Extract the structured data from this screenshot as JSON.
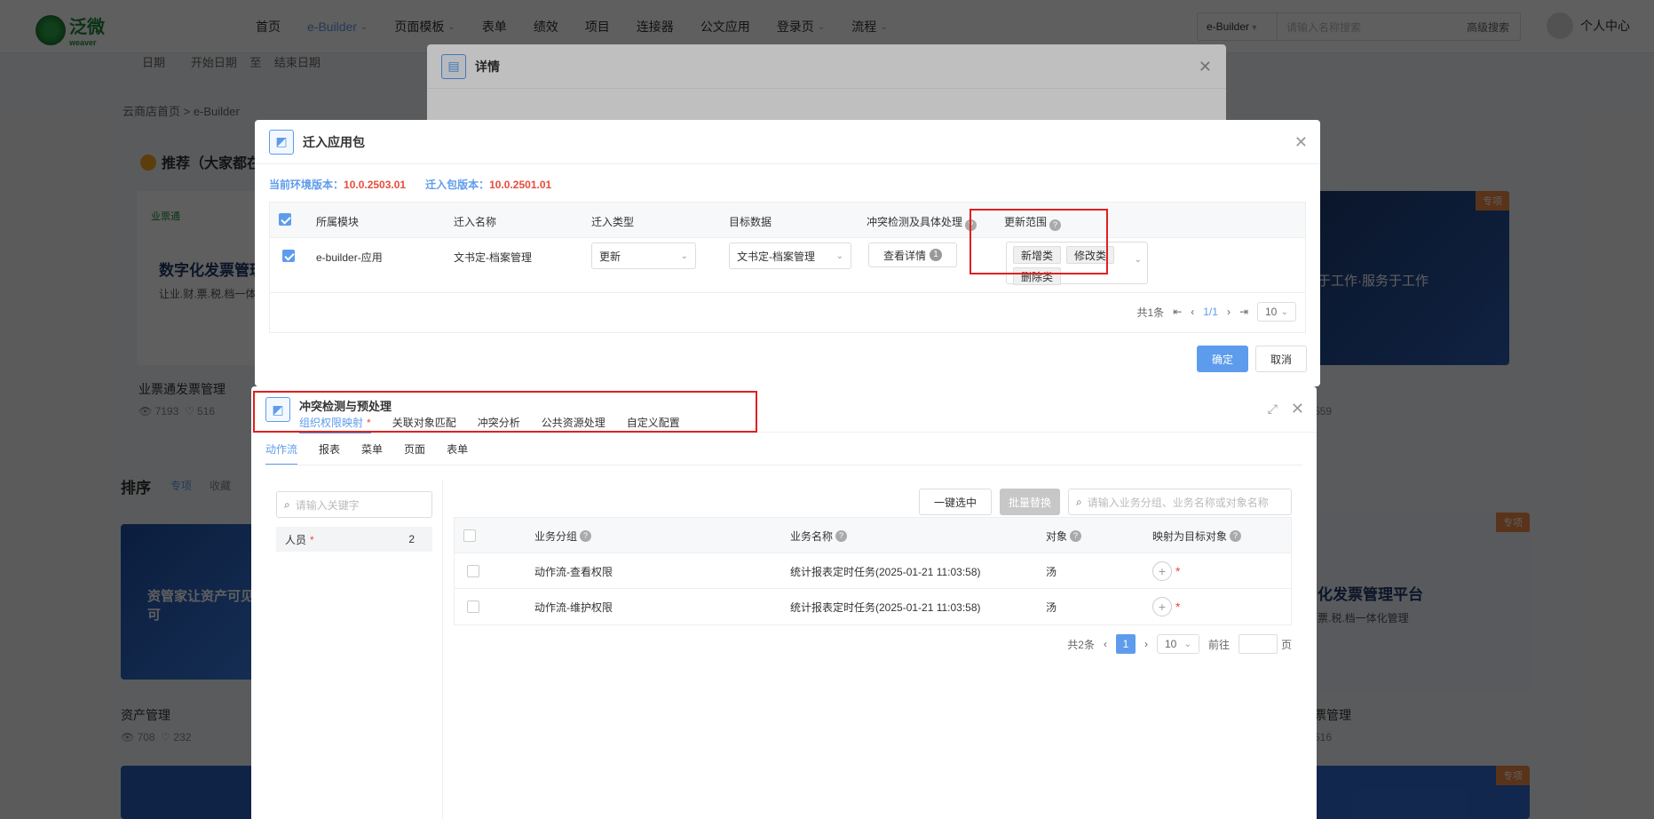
{
  "topnav": {
    "logo_text": "泛微",
    "logo_sub": "weaver",
    "items": [
      "首页",
      "e-Builder",
      "页面模板",
      "表单",
      "绩效",
      "项目",
      "连接器",
      "公文应用",
      "登录页",
      "流程"
    ],
    "active_index": 1,
    "dropdown_items": [
      1,
      2,
      8,
      9
    ],
    "search_scope": "e-Builder",
    "search_placeholder": "请输入名称搜索",
    "advanced_search": "高级搜索",
    "user_label": "个人中心"
  },
  "background": {
    "date_label": "日期",
    "date_start": "开始日期",
    "date_sep": "至",
    "date_end": "结束日期",
    "breadcrumb": "云商店首页 > e-Builder",
    "recommend_title": "推荐（大家都在",
    "card_a_title": "数字化发票管理",
    "card_a_sub": "让业.财.票.税.档一体",
    "card_a_brand": "业票通",
    "card_a_name": "业票通发票管理",
    "card_a_views": "7193",
    "card_a_likes": "516",
    "card_b_text": "于工作·服务于工作",
    "card_b_tag": "专项",
    "card_b_views": "559",
    "sort_title": "排序",
    "sort_tabs": [
      "专项",
      "收藏"
    ],
    "card_c_text": "资管家让资产可见 可",
    "card_c_name": "资产管理",
    "card_c_views": "708",
    "card_c_likes": "232",
    "card_d_title": "化发票管理平台",
    "card_d_sub": "票.税.档一体化管理",
    "card_d_tag": "专项",
    "card_d_name": "票管理",
    "card_d_likes": "516",
    "card_f_tag": "专项"
  },
  "detail_dialog": {
    "title": "详情"
  },
  "migrate_dialog": {
    "title": "迁入应用包",
    "env_version_label": "当前环境版本：",
    "env_version": "10.0.2503.01",
    "pkg_version_label": "迁入包版本：",
    "pkg_version": "10.0.2501.01",
    "columns": [
      "所属模块",
      "迁入名称",
      "迁入类型",
      "目标数据",
      "冲突检测及具体处理",
      "更新范围"
    ],
    "row": {
      "module": "e-builder-应用",
      "name": "文书定-档案管理",
      "type": "更新",
      "target": "文书定-档案管理",
      "detail_button": "查看详情",
      "detail_badge": "1",
      "scope_tags": [
        "新增类",
        "修改类",
        "删除类"
      ]
    },
    "pager": {
      "total": "共1条",
      "page": "1/1",
      "size": "10"
    },
    "confirm": "确定",
    "cancel": "取消"
  },
  "conflict_panel": {
    "title": "冲突检测与预处理",
    "tabs": [
      "组织权限映射",
      "关联对象匹配",
      "冲突分析",
      "公共资源处理",
      "自定义配置"
    ],
    "active_tab": 0,
    "subtabs": [
      "动作流",
      "报表",
      "菜单",
      "页面",
      "表单"
    ],
    "active_subtab": 0,
    "left_search_placeholder": "请输入关键字",
    "left_items": [
      {
        "label": "人员",
        "count": "2"
      }
    ],
    "one_click_select": "一键选中",
    "batch_replace": "批量替换",
    "right_search_placeholder": "请输入业务分组、业务名称或对象名称",
    "columns": [
      "业务分组",
      "业务名称",
      "对象",
      "映射为目标对象"
    ],
    "rows": [
      {
        "group": "动作流-查看权限",
        "name": "统计报表定时任务(2025-01-21 11:03:58)",
        "object": "汤"
      },
      {
        "group": "动作流-维护权限",
        "name": "统计报表定时任务(2025-01-21 11:03:58)",
        "object": "汤"
      }
    ],
    "pager": {
      "total": "共2条",
      "current": "1",
      "size": "10",
      "goto_label": "前往",
      "page_unit": "页"
    }
  },
  "colors": {
    "accent": "#5d9cec",
    "danger": "#e02020",
    "version_value": "#e74c3c"
  }
}
